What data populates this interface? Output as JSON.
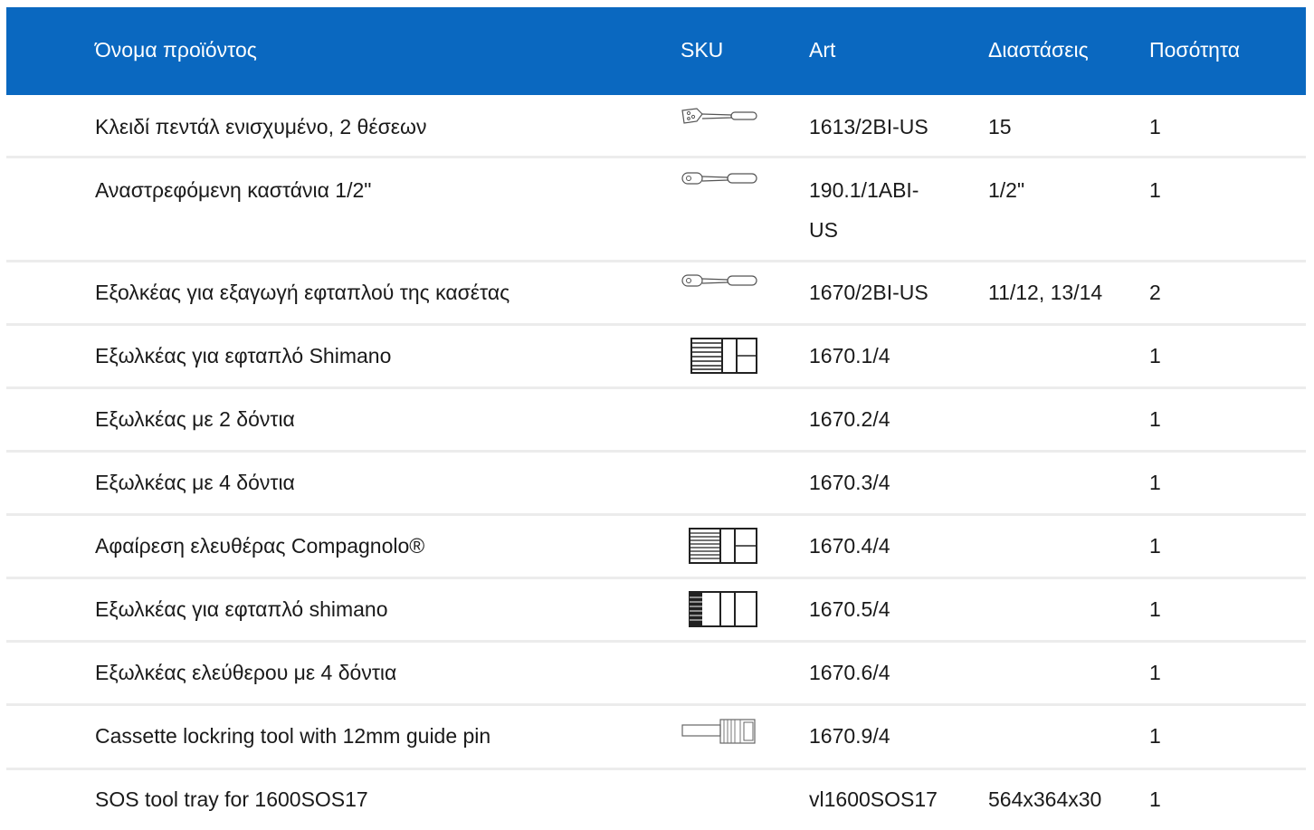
{
  "header": {
    "name": "Όνομα προϊόντος",
    "sku": "SKU",
    "art": "Art",
    "dimensions": "Διαστάσεις",
    "quantity": "Ποσότητα"
  },
  "rows": [
    {
      "name": "Κλειδί πεντάλ ενισχυμένο, 2 θέσεων",
      "icon": "pedal-wrench-icon",
      "art": "1613/2BI-US",
      "dimensions": "15",
      "quantity": "1"
    },
    {
      "name": "Αναστρεφόμενη καστάνια 1/2\"",
      "icon": "ratchet-icon",
      "art_line1": "190.1/1ABI-",
      "art_line2": "US",
      "dimensions": "1/2\"",
      "quantity": "1"
    },
    {
      "name": "Εξολκέας για εξαγωγή εφταπλού της κασέτας",
      "icon": "ratchet-icon",
      "art": "1670/2BI-US",
      "dimensions": "11/12, 13/14",
      "quantity": "2"
    },
    {
      "name": "Εξωλκέας για εφταπλό Shimano",
      "icon": "spline-socket-icon",
      "art": "1670.1/4",
      "dimensions": "",
      "quantity": "1"
    },
    {
      "name": "Εξωλκέας με 2 δόντια",
      "icon": "",
      "art": "1670.2/4",
      "dimensions": "",
      "quantity": "1"
    },
    {
      "name": "Εξωλκέας με 4 δόντια",
      "icon": "",
      "art": "1670.3/4",
      "dimensions": "",
      "quantity": "1"
    },
    {
      "name": "Αφαίρεση ελευθέρας Compagnolo®",
      "icon": "spline-socket-icon",
      "art": "1670.4/4",
      "dimensions": "",
      "quantity": "1"
    },
    {
      "name": "Εξωλκέας για εφταπλό shimano",
      "icon": "spline-socket-icon",
      "art": "1670.5/4",
      "dimensions": "",
      "quantity": "1"
    },
    {
      "name": "Εξωλκέας ελεύθερου με 4 δόντια",
      "icon": "",
      "art": "1670.6/4",
      "dimensions": "",
      "quantity": "1"
    },
    {
      "name": "Cassette lockring tool with 12mm guide pin",
      "icon": "lockring-tool-icon",
      "art": "1670.9/4",
      "dimensions": "",
      "quantity": "1"
    },
    {
      "name": "SOS tool tray for 1600SOS17",
      "icon": "",
      "art": "vl1600SOS17",
      "dimensions": "564x364x30",
      "quantity": "1"
    }
  ],
  "colors": {
    "header_bg": "#0a68c0",
    "header_text": "#ffffff",
    "divider": "#ececec"
  }
}
